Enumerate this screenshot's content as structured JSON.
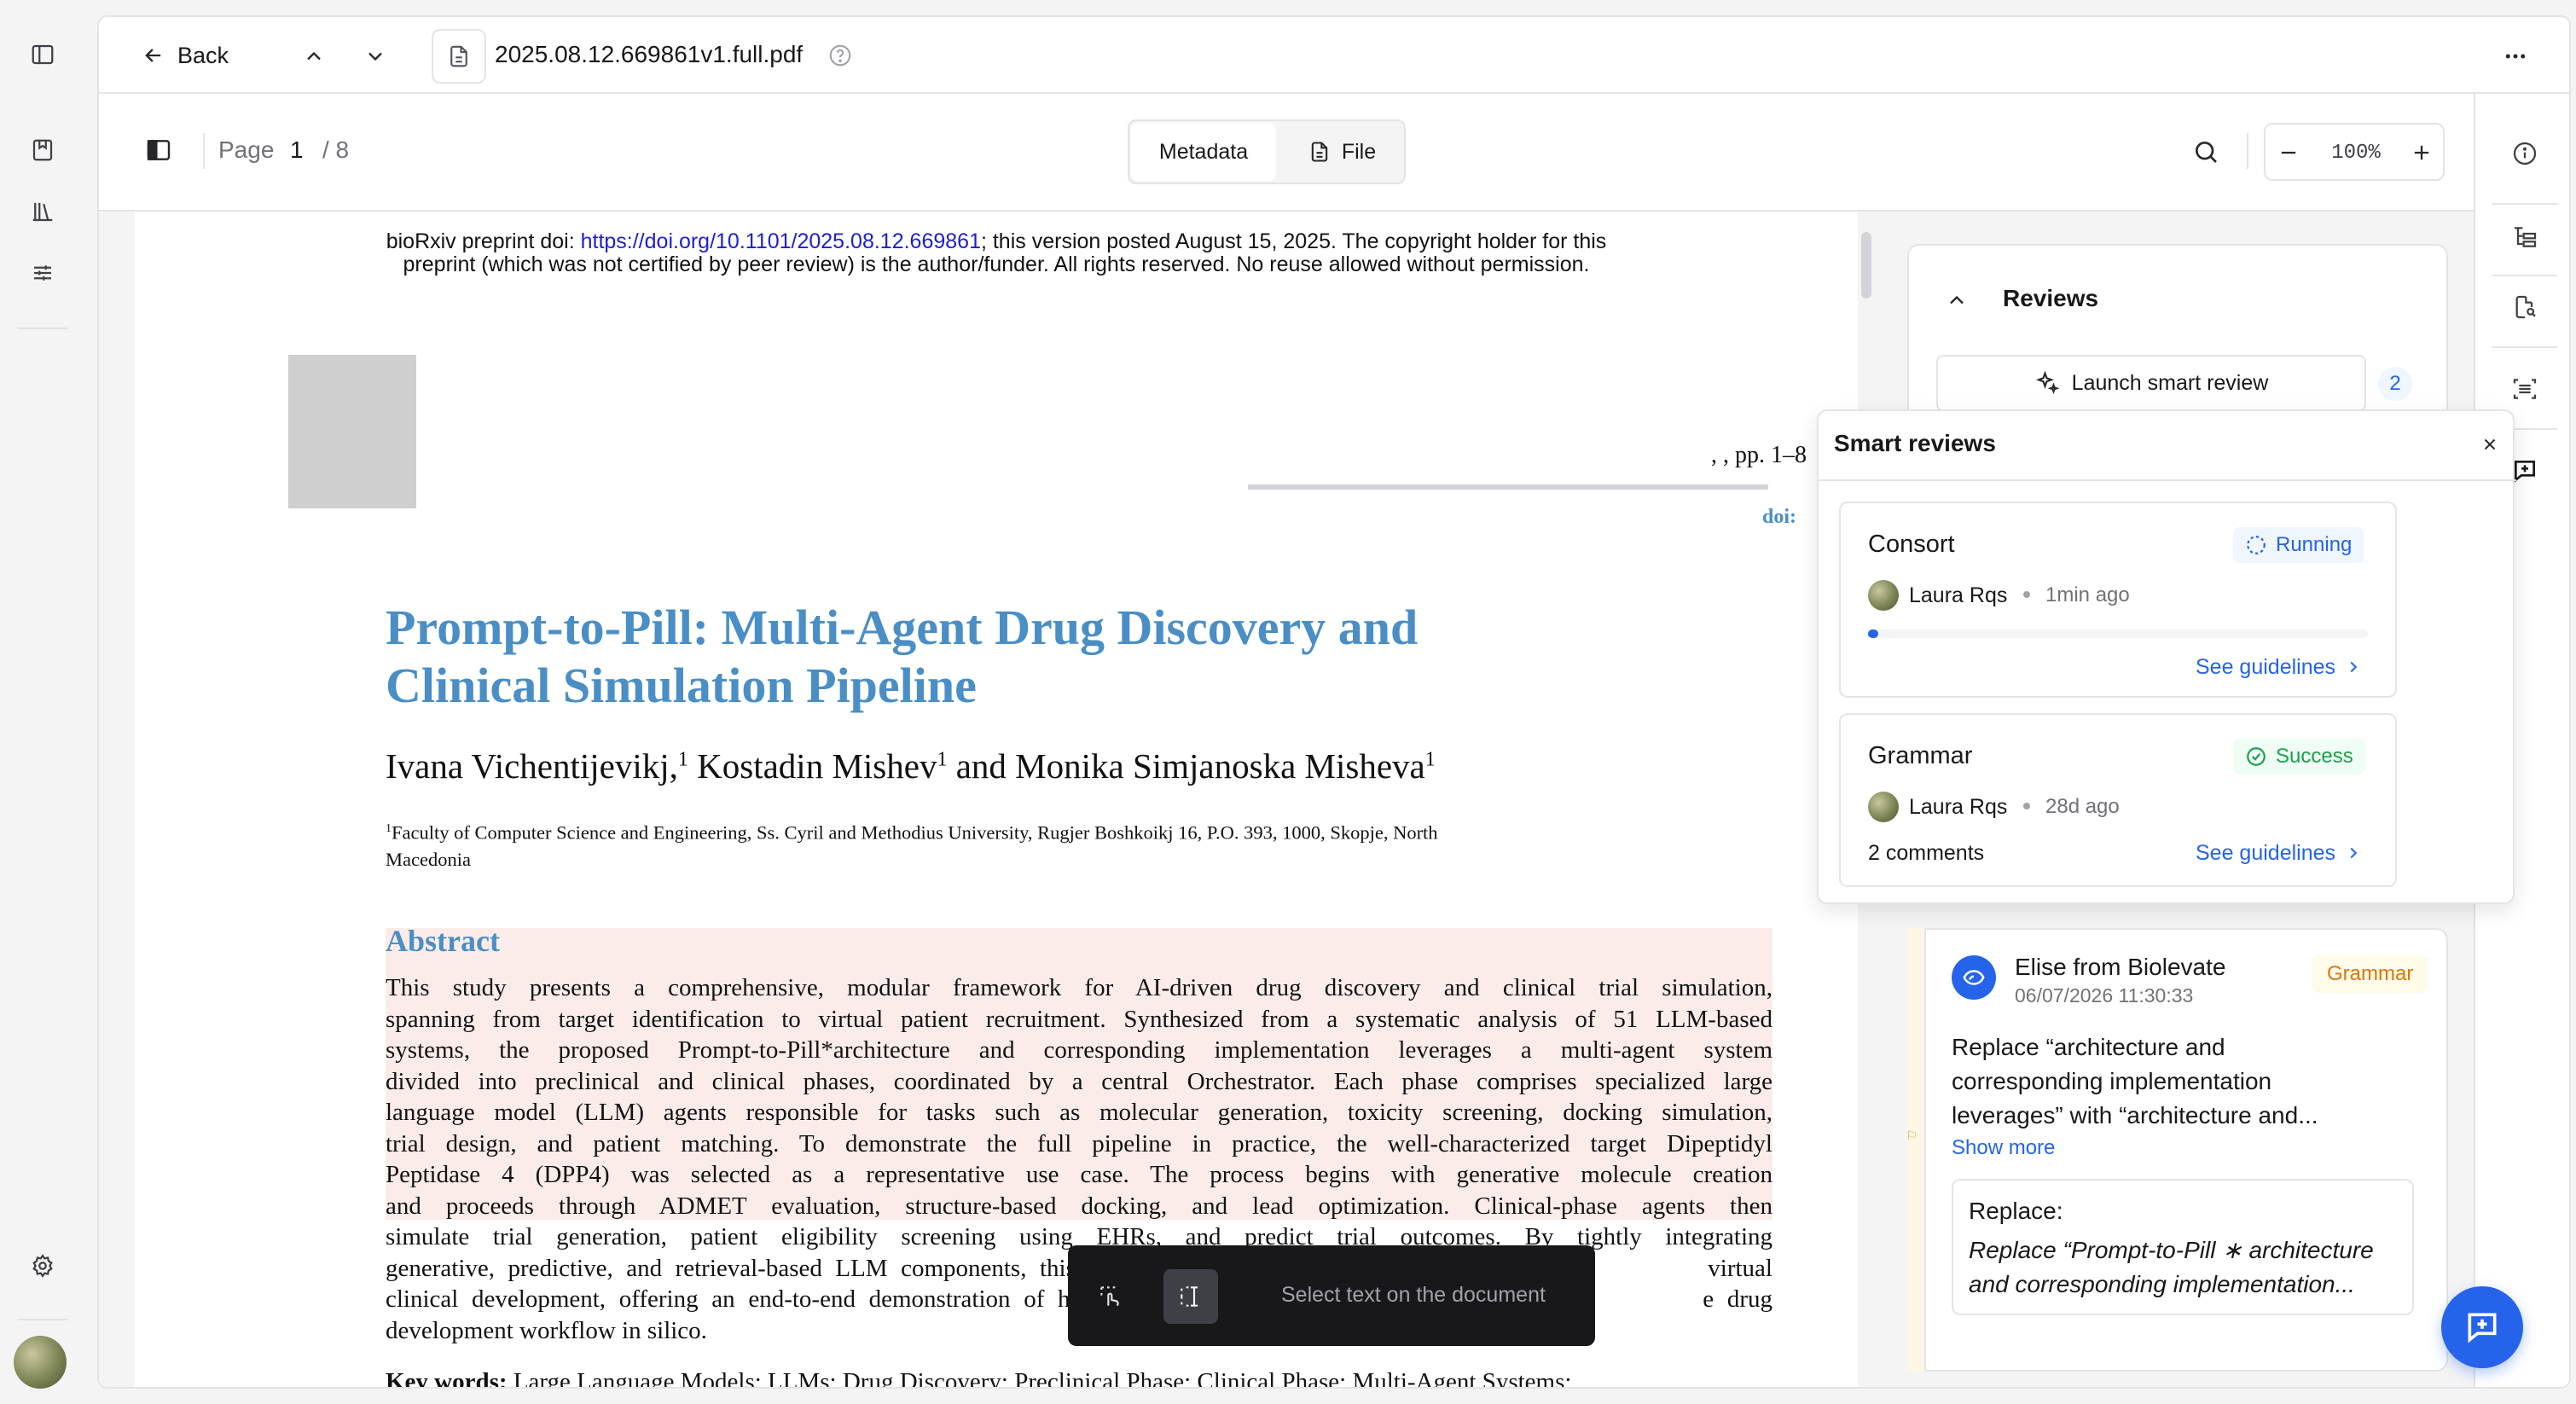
{
  "header": {
    "back_label": "Back",
    "file_name": "2025.08.12.669861v1.full.pdf"
  },
  "viewer": {
    "page_label": "Page",
    "page_current": "1",
    "page_total": "/ 8",
    "tabs": [
      "Metadata",
      "File"
    ],
    "zoom": "100%"
  },
  "document": {
    "banner_prefix": "bioRxiv preprint doi: ",
    "banner_link": "https://doi.org/10.1101/2025.08.12.669861",
    "banner_suffix": "; this version posted August 15, 2025. The copyright holder for this",
    "banner_line2": "preprint (which was not certified by peer review) is the author/funder. All rights reserved. No reuse allowed without permission.",
    "pages_ref": ", , pp. 1–8",
    "doi_label": "doi:",
    "title_line1": "Prompt-to-Pill: Multi-Agent Drug Discovery and",
    "title_line2": "Clinical Simulation Pipeline",
    "authors": [
      "Ivana Vichentijevikj,",
      "Kostadin Mishev",
      "and Monika Simjanoska Misheva"
    ],
    "author_sup": "1",
    "affiliation_sup": "1",
    "affiliation_line1": "Faculty of Computer Science and Engineering, Ss. Cyril and Methodius University, Rugjer Boshkoikj 16, P.O. 393, 1000, Skopje, North",
    "affiliation_line2": "Macedonia",
    "abstract_heading": "Abstract",
    "abstract_lines": [
      "This study presents a comprehensive, modular framework for AI-driven drug discovery and clinical trial simulation,",
      "spanning from target identification to virtual patient recruitment. Synthesized from a systematic analysis of 51 LLM-based",
      "systems, the proposed Prompt-to-Pill*architecture and corresponding implementation leverages a multi-agent system",
      "divided into preclinical and clinical phases, coordinated by a central Orchestrator. Each phase comprises specialized large",
      "language model (LLM) agents responsible for tasks such as molecular generation, toxicity screening, docking simulation,",
      "trial design, and patient matching. To demonstrate the full pipeline in practice, the well-characterized target Dipeptidyl",
      "Peptidase 4 (DPP4) was selected as a representative use case. The process begins with generative molecule creation",
      "and proceeds through ADMET evaluation, structure-based docking, and lead optimization. Clinical-phase agents then",
      "simulate trial generation, patient eligibility screening using EHRs, and predict trial outcomes. By tightly integrating",
      "generative, predictive, and retrieval-based LLM components, this a                                              virtual",
      "clinical development, offering an end-to-end demonstration of how L                                           e drug",
      "development workflow in silico."
    ],
    "keywords_label": "Key words:",
    "keywords_text": "Large Language Models; LLMs; Drug Discovery; Preclinical Phase; Clinical Phase; Multi-Agent Systems;"
  },
  "selection_toolbar": {
    "hint": "Select text on the document"
  },
  "reviews_panel": {
    "title": "Reviews",
    "launch_label": "Launch smart review",
    "count": "2"
  },
  "smart_reviews": {
    "title": "Smart reviews",
    "items": [
      {
        "name": "Consort",
        "status": "Running",
        "user": "Laura Rqs",
        "time": "1min ago",
        "progress": 0.02,
        "link": "See guidelines"
      },
      {
        "name": "Grammar",
        "status": "Success",
        "user": "Laura Rqs",
        "time": "28d ago",
        "comments": "2 comments",
        "link": "See guidelines"
      }
    ]
  },
  "comment": {
    "author": "Elise from Biolevate",
    "date": "06/07/2026 11:30:33",
    "tag": "Grammar",
    "body_lines": [
      "Replace “architecture and",
      "corresponding implementation",
      "leverages” with “architecture and..."
    ],
    "show_more": "Show more",
    "replace_label": "Replace:",
    "replace_lines": [
      "Replace “Prompt-to-Pill ∗ architecture",
      "and corresponding implementation..."
    ]
  },
  "colors": {
    "accent": "#2563eb",
    "title_blue": "#4a8ec6",
    "highlight": "#fbecea",
    "success": "#16a34a",
    "grammar": "#d97706"
  }
}
